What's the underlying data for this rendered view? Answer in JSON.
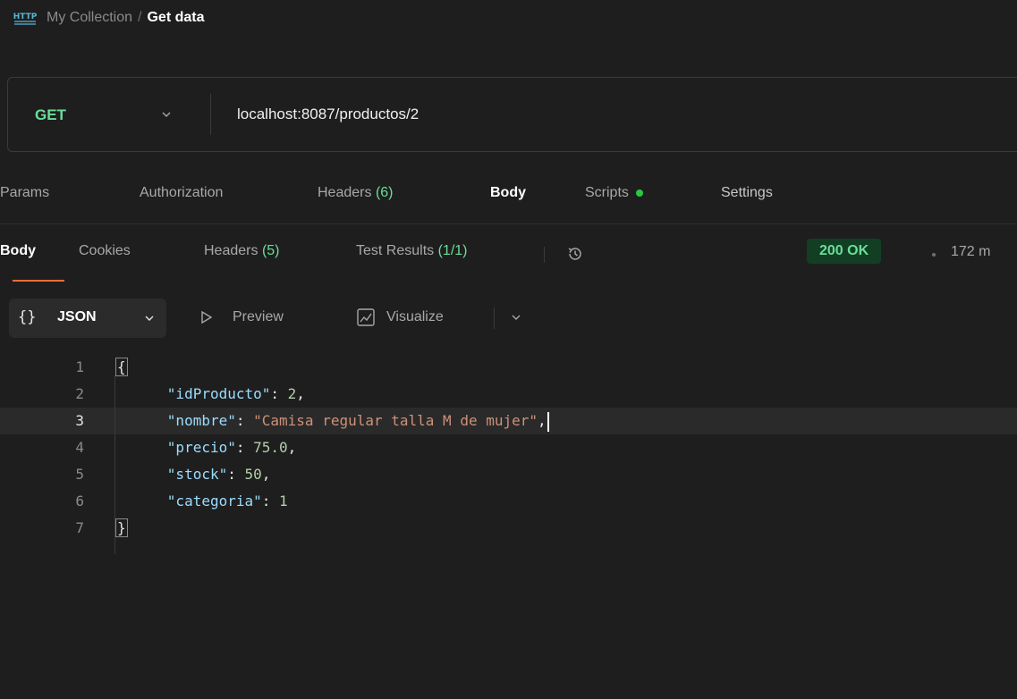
{
  "header": {
    "icon": "http-icon",
    "collection": "My Collection",
    "separator": "/",
    "request_name": "Get data"
  },
  "request": {
    "method": "GET",
    "url": "localhost:8087/productos/2"
  },
  "request_tabs": {
    "params": "Params",
    "authorization": "Authorization",
    "headers": "Headers",
    "headers_count": "(6)",
    "body": "Body",
    "scripts": "Scripts",
    "settings": "Settings"
  },
  "response_tabs": {
    "body": "Body",
    "cookies": "Cookies",
    "headers": "Headers",
    "headers_count": "(5)",
    "test_results": "Test Results",
    "test_results_count": "(1/1)",
    "history_icon": "history-icon"
  },
  "response_meta": {
    "status": "200 OK",
    "time": "172 m"
  },
  "format_bar": {
    "format_braces": "{}",
    "format": "JSON",
    "preview": "Preview",
    "visualize": "Visualize"
  },
  "editor": {
    "lines": [
      {
        "num": "1",
        "brace": "{"
      },
      {
        "num": "2",
        "key": "\"idProducto\"",
        "value": "2",
        "value_type": "number",
        "trailing": ","
      },
      {
        "num": "3",
        "key": "\"nombre\"",
        "value": "\"Camisa regular talla M de mujer\"",
        "value_type": "string",
        "trailing": ","
      },
      {
        "num": "4",
        "key": "\"precio\"",
        "value": "75.0",
        "value_type": "number",
        "trailing": ","
      },
      {
        "num": "5",
        "key": "\"stock\"",
        "value": "50",
        "value_type": "number",
        "trailing": ","
      },
      {
        "num": "6",
        "key": "\"categoria\"",
        "value": "1",
        "value_type": "number",
        "trailing": ""
      },
      {
        "num": "7",
        "brace": "}"
      }
    ],
    "current_line": "3"
  },
  "colors": {
    "accent": "#ff6c37",
    "method_green": "#6bdd9a",
    "status_bg": "#123f24",
    "scripts_dot": "#27c93f"
  }
}
